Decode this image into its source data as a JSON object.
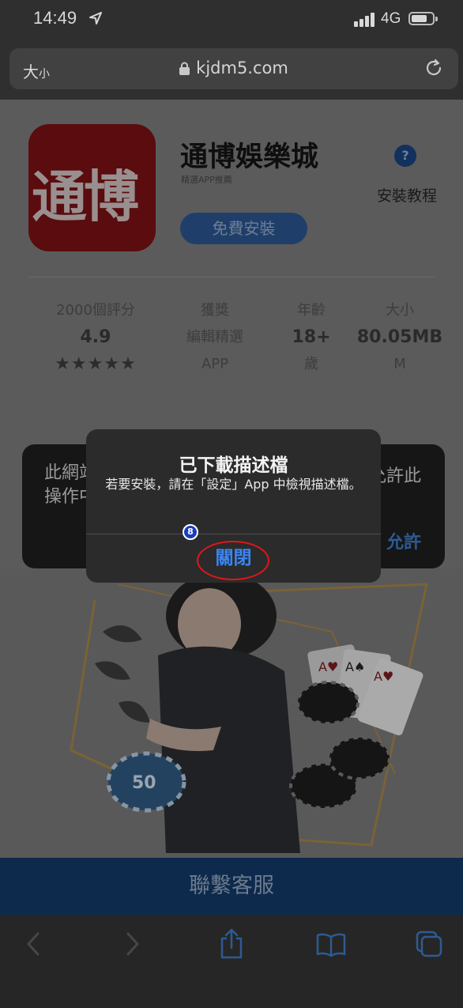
{
  "status_bar": {
    "time": "14:49",
    "network": "4G"
  },
  "address_bar": {
    "text_size_big": "大",
    "text_size_small": "小",
    "url": "kjdm5.com"
  },
  "app": {
    "icon_text": "通博",
    "name": "通博娛樂城",
    "subtitle": "精選APP推薦",
    "help_icon": "?",
    "help_label": "安裝教程",
    "install_button": "免費安裝"
  },
  "stats": [
    {
      "label": "2000個評分",
      "value": "4.9",
      "extra": "★★★★★"
    },
    {
      "label": "獲獎",
      "value": "編輯精選",
      "extra": "APP"
    },
    {
      "label": "年齡",
      "value": "18+",
      "extra": "歲"
    },
    {
      "label": "大小",
      "value": "80.05MB",
      "extra": "M"
    }
  ],
  "background_alert": {
    "line1_left": "此網站",
    "line2_left": "操作中",
    "line1_right": "允許此",
    "allow_button": "允許"
  },
  "promo": {
    "chip_value": "50"
  },
  "contact_button": "聯繫客服",
  "modal": {
    "title": "已下載描述檔",
    "message": "若要安裝，請在「設定」App 中檢視描述檔。",
    "close_button": "關閉"
  },
  "annotation": {
    "marker_number": "8",
    "ring_color": "#e11717"
  },
  "colors": {
    "link_blue": "#3a86f3",
    "icon_red": "#5a0c0e",
    "contact_bar": "#0d2a4d"
  },
  "toolbar_icons": [
    "back-icon",
    "forward-icon",
    "share-icon",
    "bookmarks-icon",
    "tabs-icon"
  ]
}
